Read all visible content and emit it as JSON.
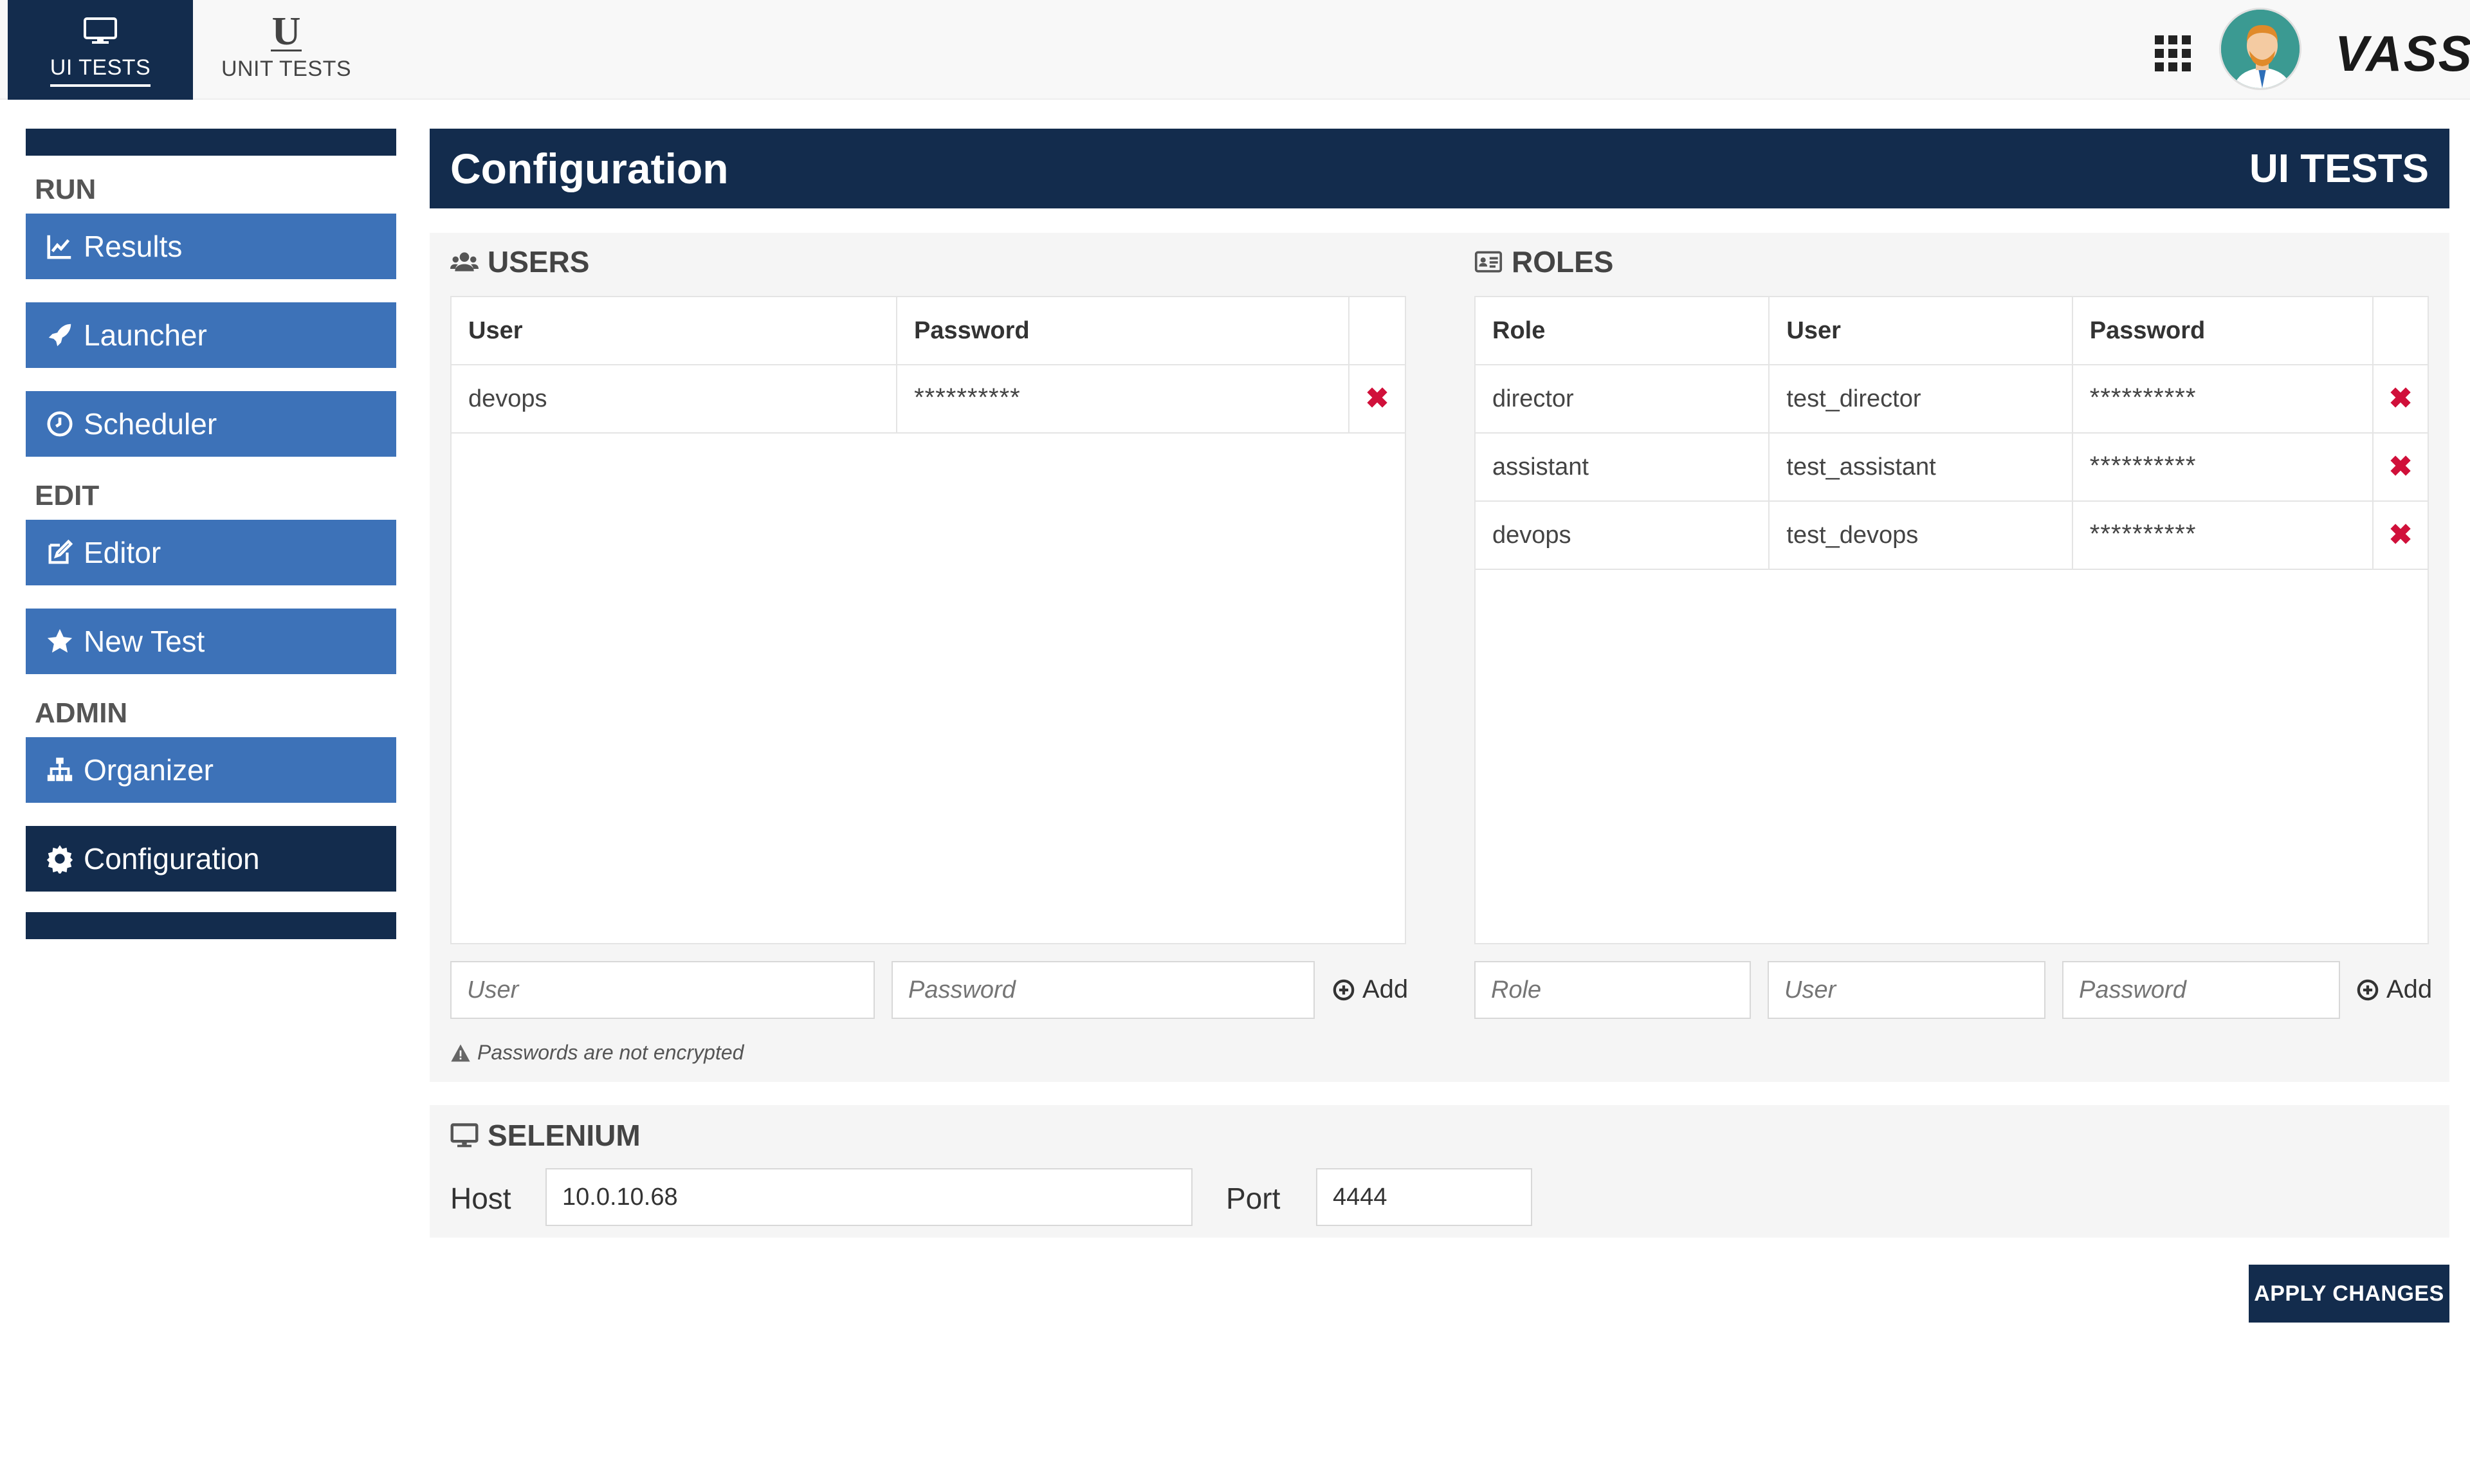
{
  "topbar": {
    "tabs": [
      {
        "label": "UI TESTS",
        "icon": "monitor-icon",
        "active": true
      },
      {
        "label": "UNIT TESTS",
        "icon": "underline-u-icon",
        "glyph": "U",
        "active": false
      }
    ],
    "brand": "VASS"
  },
  "sidebar": {
    "sections": [
      {
        "title": "RUN",
        "items": [
          {
            "label": "Results",
            "icon": "line-chart-icon"
          },
          {
            "label": "Launcher",
            "icon": "rocket-icon"
          },
          {
            "label": "Scheduler",
            "icon": "clock-icon"
          }
        ]
      },
      {
        "title": "EDIT",
        "items": [
          {
            "label": "Editor",
            "icon": "edit-icon"
          },
          {
            "label": "New Test",
            "icon": "star-icon"
          }
        ]
      },
      {
        "title": "ADMIN",
        "items": [
          {
            "label": "Organizer",
            "icon": "sitemap-icon"
          },
          {
            "label": "Configuration",
            "icon": "gear-icon",
            "active": true
          }
        ]
      }
    ]
  },
  "header": {
    "title": "Configuration",
    "subtitle": "UI TESTS"
  },
  "users": {
    "title": "USERS",
    "columns": [
      "User",
      "Password"
    ],
    "rows": [
      {
        "user": "devops",
        "password": "**********"
      }
    ],
    "inputs": {
      "user_placeholder": "User",
      "password_placeholder": "Password"
    },
    "add_label": "Add"
  },
  "roles": {
    "title": "ROLES",
    "columns": [
      "Role",
      "User",
      "Password"
    ],
    "rows": [
      {
        "role": "director",
        "user": "test_director",
        "password": "**********"
      },
      {
        "role": "assistant",
        "user": "test_assistant",
        "password": "**********"
      },
      {
        "role": "devops",
        "user": "test_devops",
        "password": "**********"
      }
    ],
    "inputs": {
      "role_placeholder": "Role",
      "user_placeholder": "User",
      "password_placeholder": "Password"
    },
    "add_label": "Add"
  },
  "warning": "Passwords are not encrypted",
  "selenium": {
    "title": "SELENIUM",
    "host_label": "Host",
    "host_value": "10.0.10.68",
    "port_label": "Port",
    "port_value": "4444"
  },
  "apply_label": "APPLY CHANGES",
  "colors": {
    "navy": "#132c4d",
    "blue": "#3d72b8",
    "delete": "#d0103a",
    "panel": "#f5f5f5"
  }
}
